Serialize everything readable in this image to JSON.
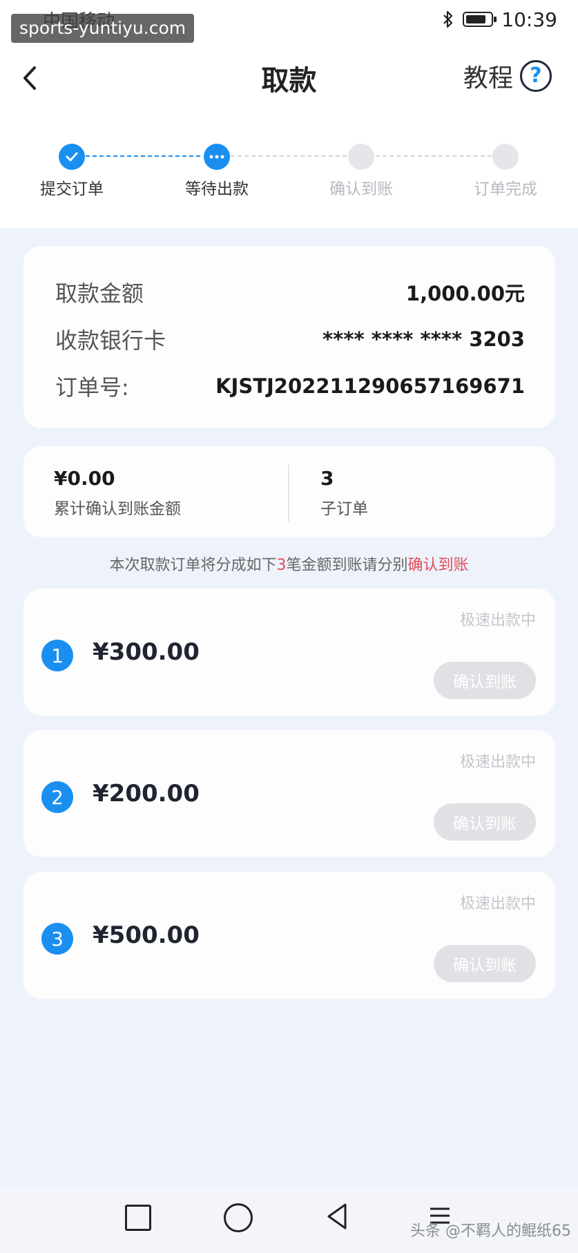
{
  "status_bar": {
    "carrier": "中国移动",
    "time": "10:39",
    "watermark": "sports-yuntiyu.com"
  },
  "header": {
    "title": "取款",
    "tutorial_label": "教程",
    "help_symbol": "?"
  },
  "steps": [
    {
      "label": "提交订单",
      "state": "done"
    },
    {
      "label": "等待出款",
      "state": "active"
    },
    {
      "label": "确认到账",
      "state": "todo"
    },
    {
      "label": "订单完成",
      "state": "todo"
    }
  ],
  "order": {
    "amount_label": "取款金额",
    "amount_value": "1,000.00元",
    "card_label": "收款银行卡",
    "card_value": "**** **** **** 3203",
    "order_label": "订单号:",
    "order_value": "KJSTJ20221129065716967​1"
  },
  "summary": {
    "confirmed_value": "¥0.00",
    "confirmed_label": "累计确认到账金额",
    "suborder_value": "3",
    "suborder_label": "子订单"
  },
  "notice": {
    "prefix": "本次取款订单将分成如下",
    "count": "3",
    "middle": "笔金额到账请分别",
    "highlight": "确认到账"
  },
  "payments": [
    {
      "index": "1",
      "amount": "¥300.00",
      "status": "极速出款中",
      "button": "确认到账"
    },
    {
      "index": "2",
      "amount": "¥200.00",
      "status": "极速出款中",
      "button": "确认到账"
    },
    {
      "index": "3",
      "amount": "¥500.00",
      "status": "极速出款中",
      "button": "确认到账"
    }
  ],
  "footer": {
    "watermark": "头条 @不羁人的鲲纸65"
  },
  "colors": {
    "accent": "#1a8ff0",
    "highlight_red": "#e04b54",
    "disabled_button": "#dfe1e4"
  }
}
